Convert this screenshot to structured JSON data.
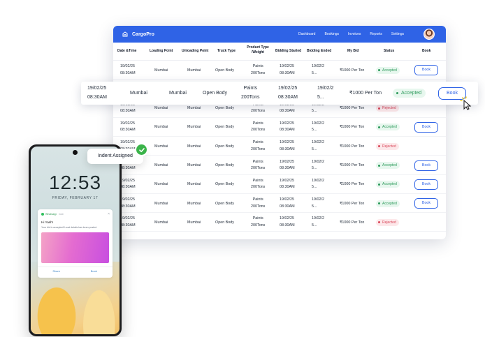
{
  "app": {
    "brand": "CargoPro",
    "brand_color": "#2f63e6"
  },
  "nav": [
    "Dashboard",
    "Bookings",
    "Invoices",
    "Reports",
    "Settings"
  ],
  "columns": {
    "date": "Date &Time",
    "loading": "Loading Point",
    "unloading": "Unloading Point",
    "truck": "Truck Type",
    "product_1": "Product Type",
    "product_2": "/Weight",
    "bid_start": "Bidding Started",
    "bid_end": "Bidding Ended",
    "my_bid": "My Bid",
    "status": "Status",
    "book": "Book"
  },
  "rows": [
    {
      "date": "19/02/25",
      "time": "08:30AM",
      "loading": "Mumbai",
      "unloading": "Mumbai",
      "truck": "Open Body",
      "product": "Paints",
      "weight": "200Tons",
      "bid_start_date": "19/02/25",
      "bid_start_time": "08:30AM",
      "bid_end_date": "19/02/2",
      "bid_end_time": "5...",
      "my_bid": "₹1000 Per Ton",
      "status": "Accepted",
      "book": "Book"
    },
    {
      "date": "",
      "time": "",
      "loading": "",
      "unloading": "",
      "truck": "",
      "product": "",
      "weight": "",
      "bid_start_date": "",
      "bid_start_time": "",
      "bid_end_date": "",
      "bid_end_time": "",
      "my_bid": "",
      "status": "",
      "book": ""
    },
    {
      "date": "19/02/25",
      "time": "08:30AM",
      "loading": "Mumbai",
      "unloading": "Mumbai",
      "truck": "Open Body",
      "product": "Paints",
      "weight": "200Tons",
      "bid_start_date": "19/02/25",
      "bid_start_time": "08:30AM",
      "bid_end_date": "19/02/2",
      "bid_end_time": "5...",
      "my_bid": "₹1000 Per Ton",
      "status": "Rejected",
      "book": ""
    },
    {
      "date": "19/02/25",
      "time": "08:30AM",
      "loading": "Mumbai",
      "unloading": "Mumbai",
      "truck": "Open Body",
      "product": "Paints",
      "weight": "200Tons",
      "bid_start_date": "19/02/25",
      "bid_start_time": "08:30AM",
      "bid_end_date": "19/02/2",
      "bid_end_time": "5...",
      "my_bid": "₹1000 Per Ton",
      "status": "Accepted",
      "book": "Book"
    },
    {
      "date": "19/02/25",
      "time": "08:30AM",
      "loading": "Mumbai",
      "unloading": "Mumbai",
      "truck": "Open Body",
      "product": "Paints",
      "weight": "200Tons",
      "bid_start_date": "19/02/25",
      "bid_start_time": "08:30AM",
      "bid_end_date": "19/02/2",
      "bid_end_time": "5...",
      "my_bid": "₹1000 Per Ton",
      "status": "Rejected",
      "book": ""
    },
    {
      "date": "19/02/25",
      "time": "08:30AM",
      "loading": "Mumbai",
      "unloading": "Mumbai",
      "truck": "Open Body",
      "product": "Paints",
      "weight": "200Tons",
      "bid_start_date": "19/02/25",
      "bid_start_time": "08:30AM",
      "bid_end_date": "19/02/2",
      "bid_end_time": "5...",
      "my_bid": "₹1000 Per Ton",
      "status": "Accepted",
      "book": "Book"
    },
    {
      "date": "19/02/25",
      "time": "08:30AM",
      "loading": "Mumbai",
      "unloading": "Mumbai",
      "truck": "Open Body",
      "product": "Paints",
      "weight": "200Tons",
      "bid_start_date": "19/02/25",
      "bid_start_time": "08:30AM",
      "bid_end_date": "19/02/2",
      "bid_end_time": "5...",
      "my_bid": "₹1000 Per Ton",
      "status": "Accepted",
      "book": "Book"
    },
    {
      "date": "19/02/25",
      "time": "08:30AM",
      "loading": "Mumbai",
      "unloading": "Mumbai",
      "truck": "Open Body",
      "product": "Paints",
      "weight": "200Tons",
      "bid_start_date": "19/02/25",
      "bid_start_time": "08:30AM",
      "bid_end_date": "19/02/2",
      "bid_end_time": "5...",
      "my_bid": "₹1000 Per Ton",
      "status": "Accepted",
      "book": "Book"
    },
    {
      "date": "19/02/25",
      "time": "08:30AM",
      "loading": "Mumbai",
      "unloading": "Mumbai",
      "truck": "Open Body",
      "product": "Paints",
      "weight": "200Tons",
      "bid_start_date": "19/02/25",
      "bid_start_time": "08:30AM",
      "bid_end_date": "19/02/2",
      "bid_end_time": "5...",
      "my_bid": "₹1000 Per Ton",
      "status": "Rejected",
      "book": ""
    }
  ],
  "highlight": {
    "date": "19/02/25",
    "time": "08:30AM",
    "loading": "Mumbai",
    "unloading": "Mumbai",
    "truck": "Open Body",
    "product": "Paints",
    "weight": "200Tons",
    "bid_start_date": "19/02/25",
    "bid_start_time": "08:30AM",
    "bid_end_date": "19/02/2",
    "bid_end_time": "5...",
    "my_bid": "₹1000 Per Ton",
    "status": "Accepted",
    "book": "Book"
  },
  "status_colors": {
    "Accepted": "#2d9a5b",
    "Rejected": "#d9475a"
  },
  "toast": {
    "text": "Indent Assigned",
    "icon": "check-icon"
  },
  "phone": {
    "time": "12:53",
    "date": "FRIDAY, FEBRUARY 17",
    "notification": {
      "app": "Whatsapp",
      "age": "now",
      "title": "Hi Yash!",
      "body": "Your bid is accepted! Load details has been posted.",
      "actions": [
        "Share",
        "Book"
      ]
    }
  }
}
